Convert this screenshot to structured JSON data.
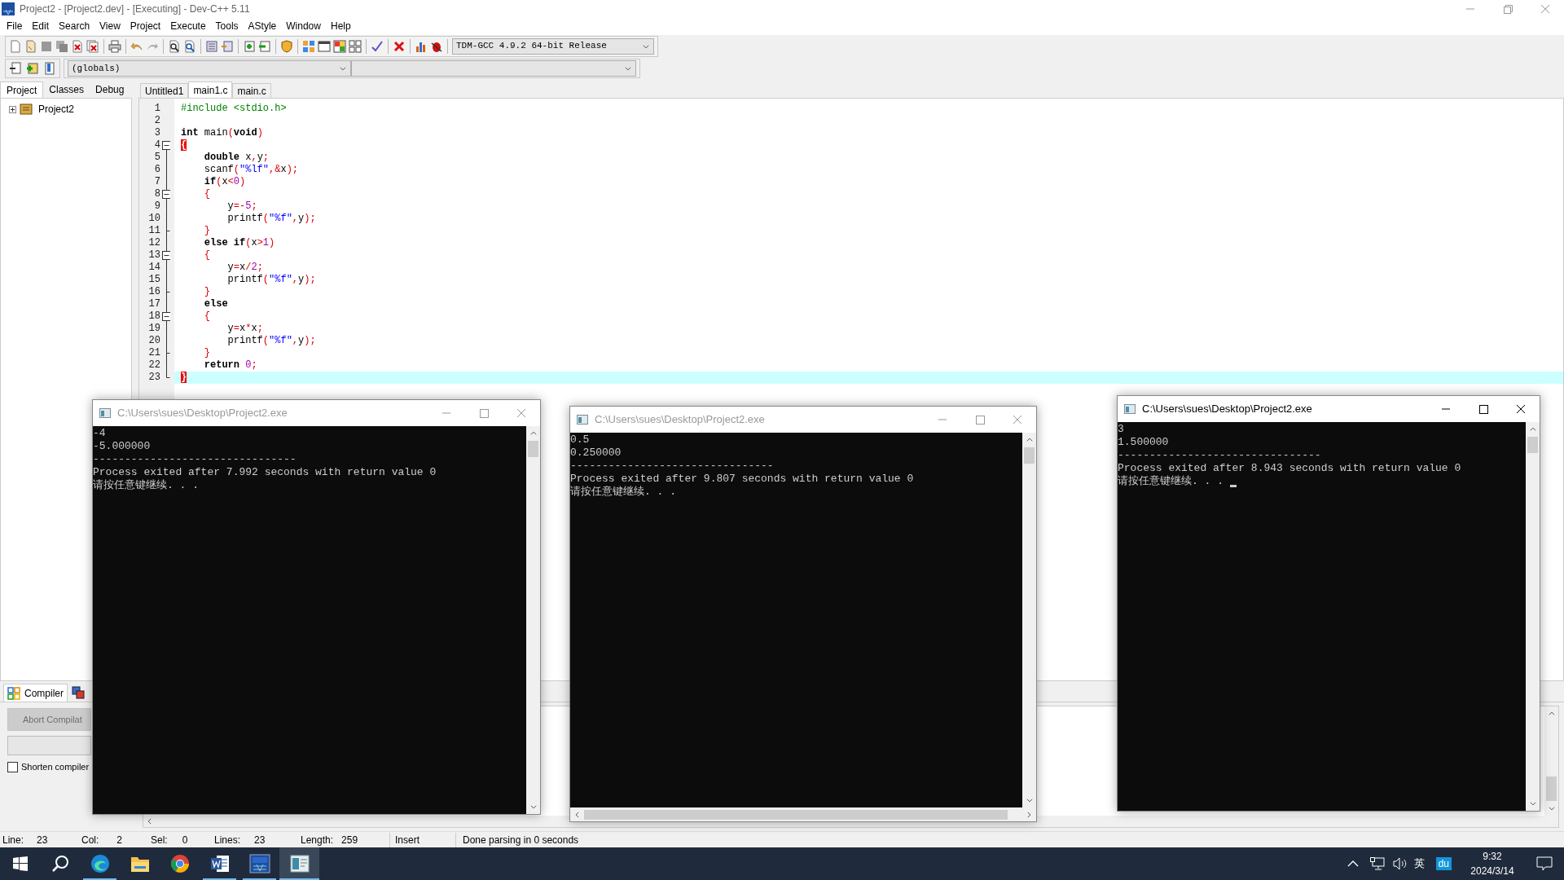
{
  "window": {
    "title": "Project2 - [Project2.dev] - [Executing] - Dev-C++ 5.11"
  },
  "menu": [
    "File",
    "Edit",
    "Search",
    "View",
    "Project",
    "Execute",
    "Tools",
    "AStyle",
    "Window",
    "Help"
  ],
  "compiler_select": {
    "value": "TDM-GCC 4.9.2 64-bit Release"
  },
  "scope_select": {
    "value": "(globals)"
  },
  "side_tabs": [
    {
      "label": "Project",
      "selected": true
    },
    {
      "label": "Classes",
      "selected": false
    },
    {
      "label": "Debug",
      "selected": false
    }
  ],
  "project_tree": [
    {
      "label": "Project2",
      "expanded": false
    }
  ],
  "editor_tabs": [
    {
      "label": "Untitled1",
      "selected": false
    },
    {
      "label": "main1.c",
      "selected": true
    },
    {
      "label": "main.c",
      "selected": false
    }
  ],
  "code_lines": [
    {
      "number": "1",
      "segments": [
        {
          "kind": "pre",
          "text": "#include <stdio.h>"
        }
      ]
    },
    {
      "number": "2"
    },
    {
      "number": "3",
      "segments": [
        {
          "kind": "kw",
          "text": "int"
        },
        {
          "kind": "id",
          "text": " main"
        },
        {
          "kind": "sym",
          "text": "("
        },
        {
          "kind": "kw",
          "text": "void"
        },
        {
          "kind": "sym",
          "text": ")"
        }
      ]
    },
    {
      "number": "4",
      "fold_open": true,
      "segments": [
        {
          "kind": "brace",
          "text": "{"
        }
      ]
    },
    {
      "number": "5",
      "segments": [
        {
          "kind": "kw",
          "text": "    double"
        },
        {
          "kind": "id",
          "text": " x"
        },
        {
          "kind": "sym",
          "text": ","
        },
        {
          "kind": "id",
          "text": "y"
        },
        {
          "kind": "sym",
          "text": ";"
        }
      ]
    },
    {
      "number": "6",
      "segments": [
        {
          "kind": "id",
          "text": "    scanf"
        },
        {
          "kind": "sym",
          "text": "("
        },
        {
          "kind": "str",
          "text": "\"%lf\""
        },
        {
          "kind": "sym",
          "text": ",&"
        },
        {
          "kind": "id",
          "text": "x"
        },
        {
          "kind": "sym",
          "text": ");"
        }
      ]
    },
    {
      "number": "7",
      "segments": [
        {
          "kind": "kw",
          "text": "    if"
        },
        {
          "kind": "sym",
          "text": "("
        },
        {
          "kind": "id",
          "text": "x"
        },
        {
          "kind": "sym",
          "text": "<"
        },
        {
          "kind": "num",
          "text": "0"
        },
        {
          "kind": "sym",
          "text": ")"
        }
      ]
    },
    {
      "number": "8",
      "fold_open": true,
      "segments": [
        {
          "kind": "sym",
          "text": "    {"
        }
      ]
    },
    {
      "number": "9",
      "segments": [
        {
          "kind": "id",
          "text": "        y"
        },
        {
          "kind": "sym",
          "text": "=-"
        },
        {
          "kind": "num",
          "text": "5"
        },
        {
          "kind": "sym",
          "text": ";"
        }
      ]
    },
    {
      "number": "10",
      "segments": [
        {
          "kind": "id",
          "text": "        printf"
        },
        {
          "kind": "sym",
          "text": "("
        },
        {
          "kind": "str",
          "text": "\"%f\""
        },
        {
          "kind": "sym",
          "text": ","
        },
        {
          "kind": "id",
          "text": "y"
        },
        {
          "kind": "sym",
          "text": ");"
        }
      ]
    },
    {
      "number": "11",
      "fold_close": true,
      "segments": [
        {
          "kind": "sym",
          "text": "    }"
        }
      ]
    },
    {
      "number": "12",
      "segments": [
        {
          "kind": "kw",
          "text": "    else if"
        },
        {
          "kind": "sym",
          "text": "("
        },
        {
          "kind": "id",
          "text": "x"
        },
        {
          "kind": "sym",
          "text": ">"
        },
        {
          "kind": "num",
          "text": "1"
        },
        {
          "kind": "sym",
          "text": ")"
        }
      ]
    },
    {
      "number": "13",
      "fold_open": true,
      "segments": [
        {
          "kind": "sym",
          "text": "    {"
        }
      ]
    },
    {
      "number": "14",
      "segments": [
        {
          "kind": "id",
          "text": "        y"
        },
        {
          "kind": "sym",
          "text": "="
        },
        {
          "kind": "id",
          "text": "x"
        },
        {
          "kind": "sym",
          "text": "/"
        },
        {
          "kind": "num",
          "text": "2"
        },
        {
          "kind": "sym",
          "text": ";"
        }
      ]
    },
    {
      "number": "15",
      "segments": [
        {
          "kind": "id",
          "text": "        printf"
        },
        {
          "kind": "sym",
          "text": "("
        },
        {
          "kind": "str",
          "text": "\"%f\""
        },
        {
          "kind": "sym",
          "text": ","
        },
        {
          "kind": "id",
          "text": "y"
        },
        {
          "kind": "sym",
          "text": ");"
        }
      ]
    },
    {
      "number": "16",
      "fold_close": true,
      "segments": [
        {
          "kind": "sym",
          "text": "    }"
        }
      ]
    },
    {
      "number": "17",
      "segments": [
        {
          "kind": "kw",
          "text": "    else"
        }
      ]
    },
    {
      "number": "18",
      "fold_open": true,
      "segments": [
        {
          "kind": "sym",
          "text": "    {"
        }
      ]
    },
    {
      "number": "19",
      "segments": [
        {
          "kind": "id",
          "text": "        y"
        },
        {
          "kind": "sym",
          "text": "="
        },
        {
          "kind": "id",
          "text": "x"
        },
        {
          "kind": "sym",
          "text": "*"
        },
        {
          "kind": "id",
          "text": "x"
        },
        {
          "kind": "sym",
          "text": ";"
        }
      ]
    },
    {
      "number": "20",
      "segments": [
        {
          "kind": "id",
          "text": "        printf"
        },
        {
          "kind": "sym",
          "text": "("
        },
        {
          "kind": "str",
          "text": "\"%f\""
        },
        {
          "kind": "sym",
          "text": ","
        },
        {
          "kind": "id",
          "text": "y"
        },
        {
          "kind": "sym",
          "text": ");"
        }
      ]
    },
    {
      "number": "21",
      "fold_close": true,
      "segments": [
        {
          "kind": "sym",
          "text": "    }"
        }
      ]
    },
    {
      "number": "22",
      "segments": [
        {
          "kind": "kw",
          "text": "    return"
        },
        {
          "kind": "num",
          "text": " 0"
        },
        {
          "kind": "sym",
          "text": ";"
        }
      ]
    },
    {
      "number": "23",
      "fold_close": true,
      "current": true,
      "segments": [
        {
          "kind": "brace",
          "text": "}"
        }
      ]
    }
  ],
  "bottom_tabs": [
    {
      "label": "Compiler",
      "selected": true
    }
  ],
  "compiler_panel": {
    "abort_button": {
      "label": "Abort Compilat",
      "disabled": true
    },
    "shorten_checkbox": {
      "label": "Shorten compiler",
      "checked": false
    }
  },
  "status_bar": [
    {
      "label": "Line:",
      "value": "23"
    },
    {
      "label": "Col:",
      "value": "2"
    },
    {
      "label": "Sel:",
      "value": "0"
    },
    {
      "label": "Lines:",
      "value": "23"
    },
    {
      "label": "Length:",
      "value": "259"
    }
  ],
  "status_mode": "Insert",
  "status_message": "Done parsing in 0 seconds",
  "consoles": [
    {
      "title": "C:\\Users\\sues\\Desktop\\Project2.exe",
      "active": false,
      "cursor": false,
      "horizontal_scrollbar": false,
      "lines": [
        "-4",
        "-5.000000",
        "--------------------------------",
        "Process exited after 7.992 seconds with return value 0",
        "请按任意键继续. . ."
      ]
    },
    {
      "title": "C:\\Users\\sues\\Desktop\\Project2.exe",
      "active": false,
      "cursor": false,
      "horizontal_scrollbar": true,
      "lines": [
        "0.5",
        "0.250000",
        "--------------------------------",
        "Process exited after 9.807 seconds with return value 0",
        "请按任意键继续. . ."
      ]
    },
    {
      "title": "C:\\Users\\sues\\Desktop\\Project2.exe",
      "active": true,
      "cursor": true,
      "horizontal_scrollbar": false,
      "lines": [
        "3",
        "1.500000",
        "--------------------------------",
        "Process exited after 8.943 seconds with return value 0",
        "请按任意键继续. . ."
      ]
    }
  ],
  "taskbar": {
    "apps": [
      {
        "kind": "start",
        "running": false,
        "active": false
      },
      {
        "kind": "search",
        "running": false,
        "active": false
      },
      {
        "kind": "wave",
        "running": true,
        "active": false
      },
      {
        "kind": "folder",
        "running": false,
        "active": false
      },
      {
        "kind": "ring",
        "running": false,
        "active": false
      },
      {
        "kind": "document",
        "running": true,
        "active": false
      },
      {
        "kind": "ide",
        "running": true,
        "active": false
      },
      {
        "kind": "console",
        "running": true,
        "active": true
      }
    ],
    "ime": "英",
    "badge": "du",
    "time": "9:32",
    "date": "2024/3/14"
  }
}
